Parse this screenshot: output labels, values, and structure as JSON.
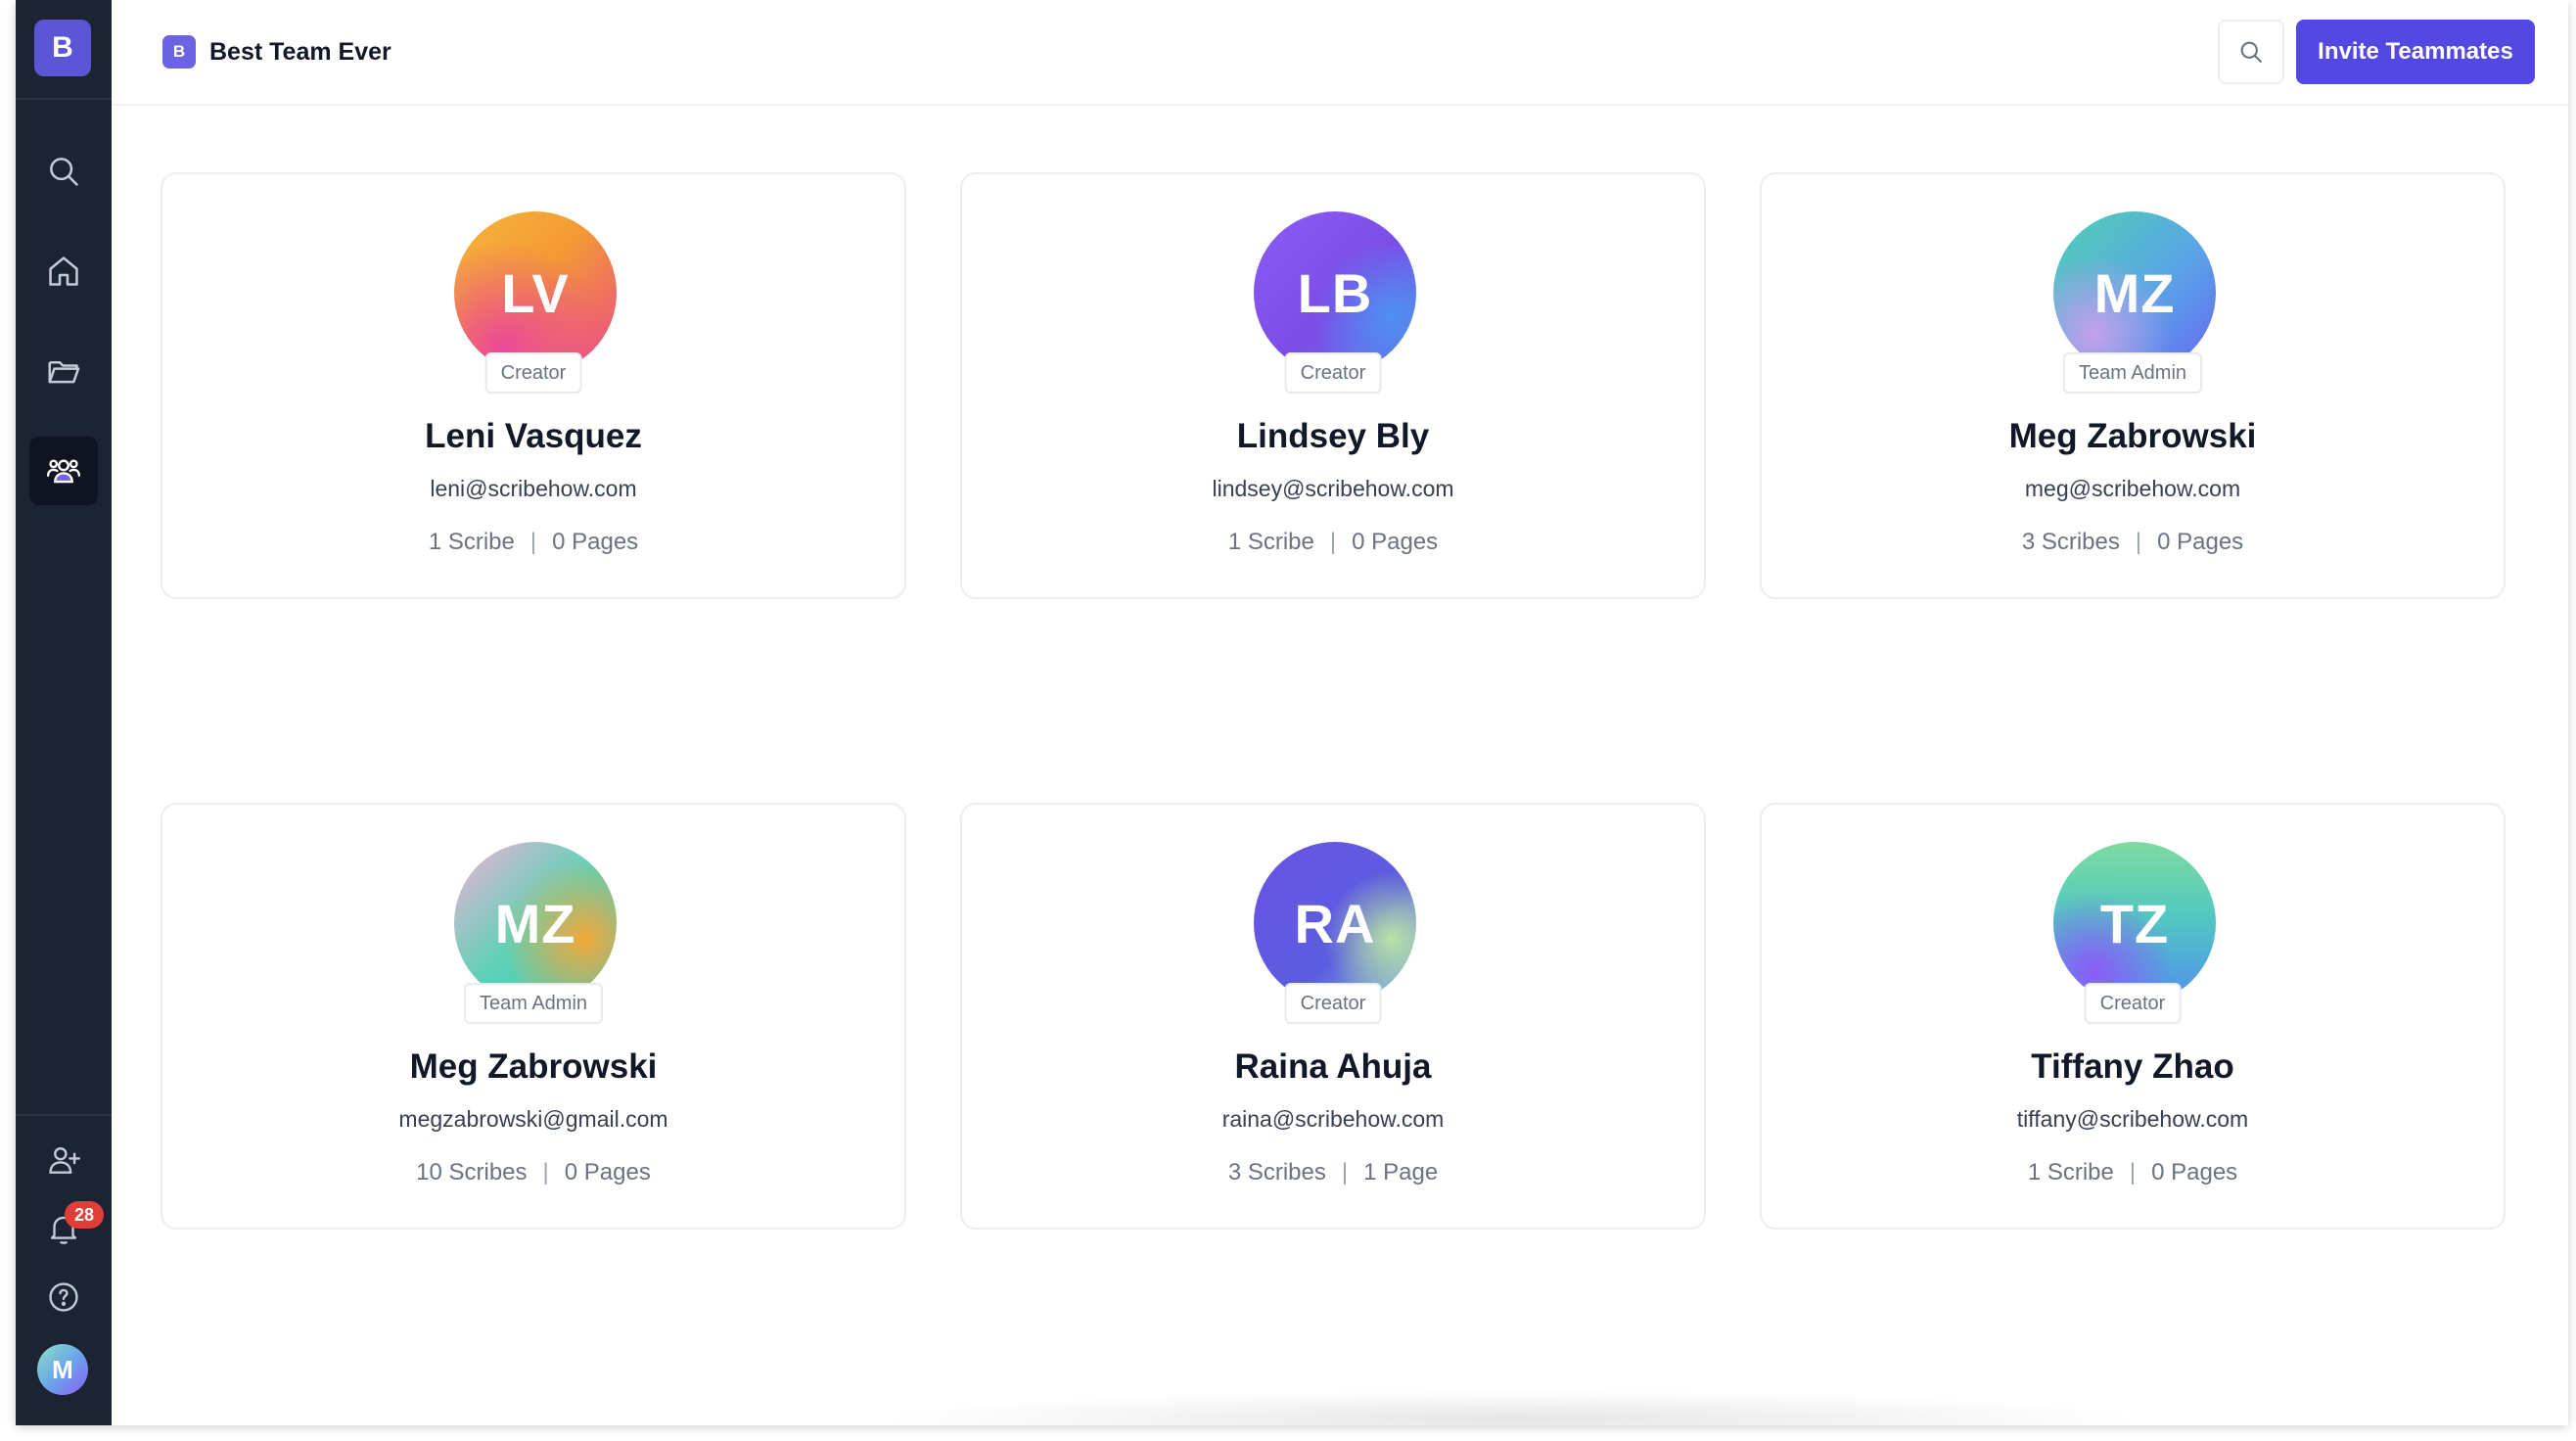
{
  "sidebar": {
    "workspace_initial": "B",
    "notification_count": "28",
    "user_initial": "M",
    "nav": [
      {
        "name": "search",
        "icon": "search-icon"
      },
      {
        "name": "home",
        "icon": "home-icon"
      },
      {
        "name": "folders",
        "icon": "folder-icon"
      },
      {
        "name": "team",
        "icon": "users-icon",
        "active": true
      }
    ],
    "bottom": [
      {
        "name": "add-user",
        "icon": "user-plus-icon"
      },
      {
        "name": "notifications",
        "icon": "bell-icon"
      },
      {
        "name": "help",
        "icon": "help-circle-icon"
      }
    ]
  },
  "header": {
    "team_initial": "B",
    "team_name": "Best Team Ever",
    "invite_label": "Invite Teammates"
  },
  "members": [
    {
      "initials": "LV",
      "role": "Creator",
      "name": "Leni Vasquez",
      "email": "leni@scribehow.com",
      "scribes": "1 Scribe",
      "pages": "0 Pages"
    },
    {
      "initials": "LB",
      "role": "Creator",
      "name": "Lindsey Bly",
      "email": "lindsey@scribehow.com",
      "scribes": "1 Scribe",
      "pages": "0 Pages"
    },
    {
      "initials": "MZ",
      "role": "Team Admin",
      "name": "Meg Zabrowski",
      "email": "meg@scribehow.com",
      "scribes": "3 Scribes",
      "pages": "0 Pages"
    },
    {
      "initials": "MZ",
      "role": "Team Admin",
      "name": "Meg Zabrowski",
      "email": "megzabrowski@gmail.com",
      "scribes": "10 Scribes",
      "pages": "0 Pages"
    },
    {
      "initials": "RA",
      "role": "Creator",
      "name": "Raina Ahuja",
      "email": "raina@scribehow.com",
      "scribes": "3 Scribes",
      "pages": "1 Page"
    },
    {
      "initials": "TZ",
      "role": "Creator",
      "name": "Tiffany Zhao",
      "email": "tiffany@scribehow.com",
      "scribes": "1 Scribe",
      "pages": "0 Pages"
    }
  ],
  "colors": {
    "sidebar_bg": "#1c2434",
    "accent": "#5448e3",
    "notification_badge": "#e03e36"
  }
}
